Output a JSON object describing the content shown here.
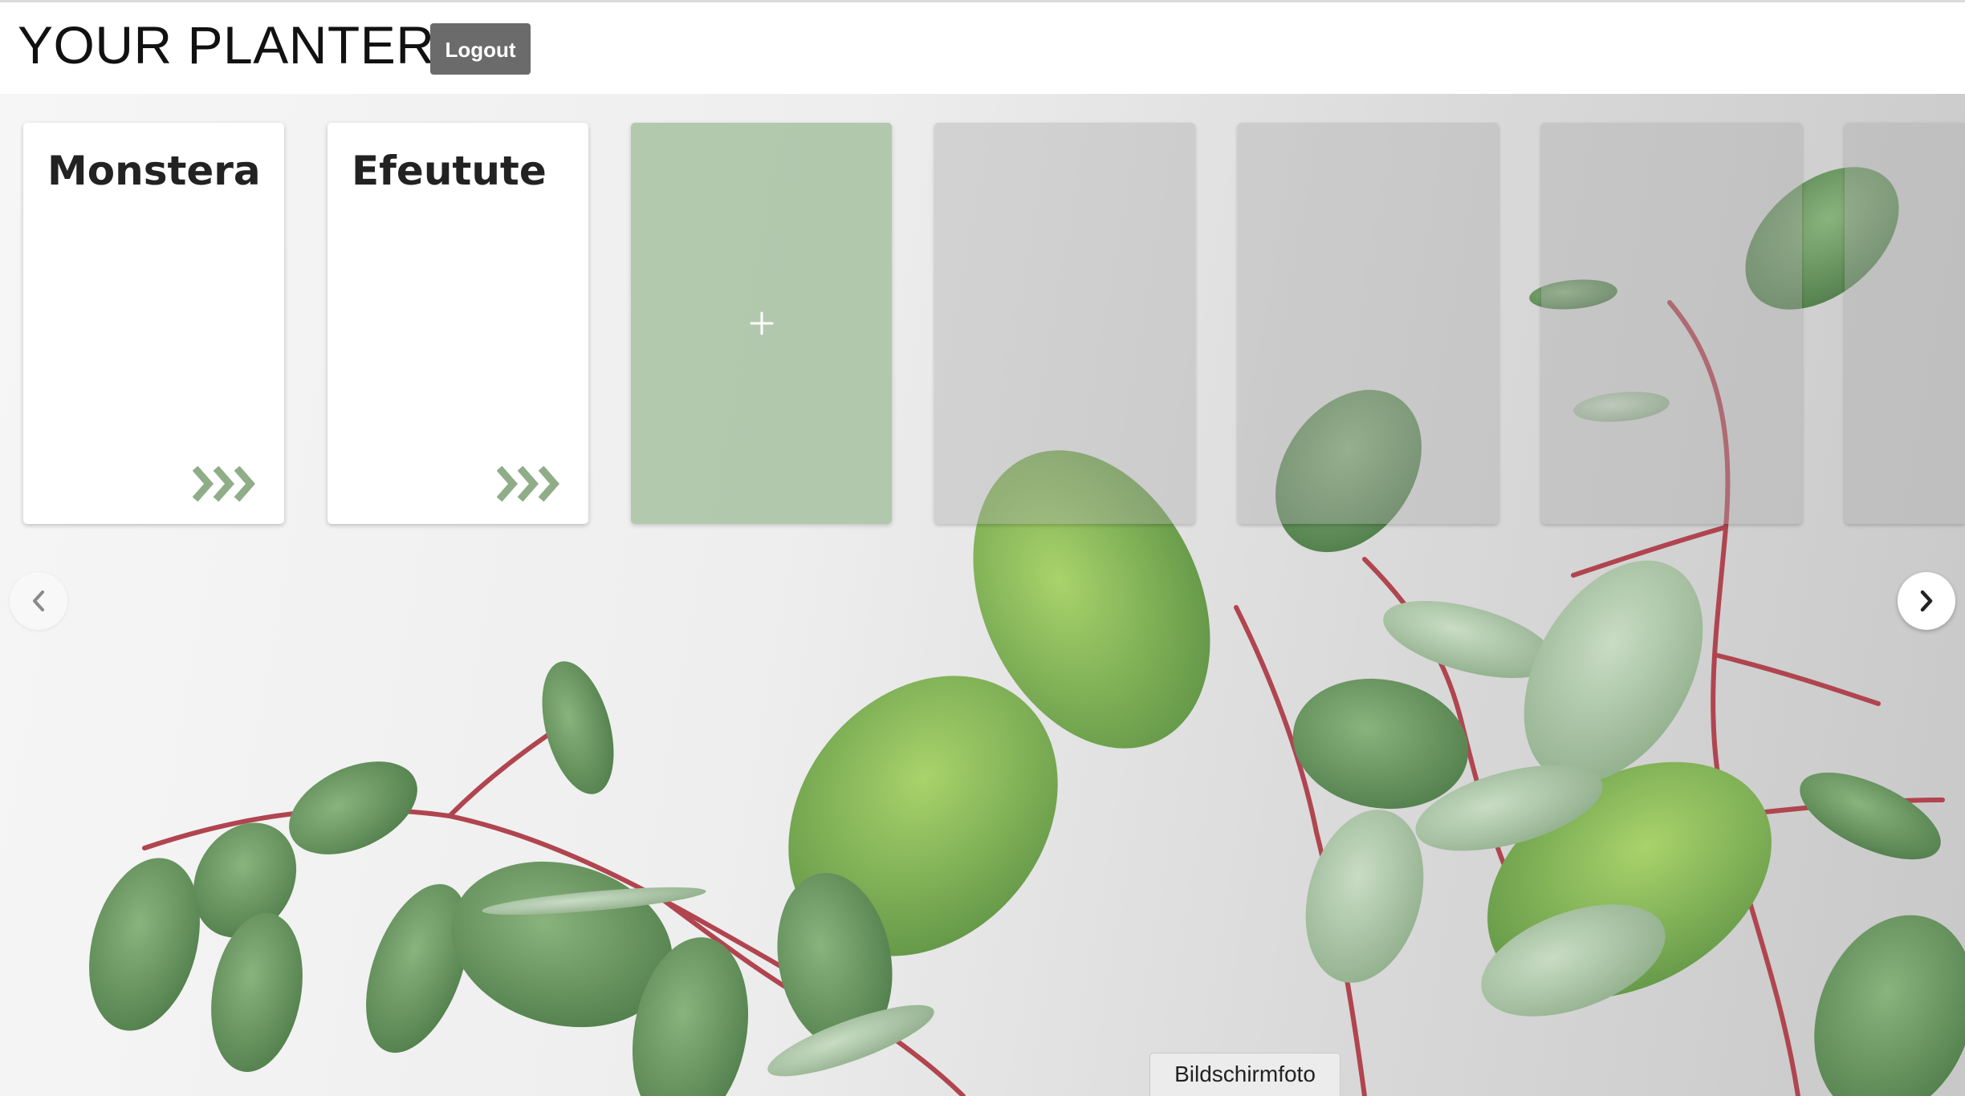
{
  "header": {
    "title": "YOUR PLANTER",
    "logout_label": "Logout"
  },
  "carousel": {
    "cards": [
      {
        "type": "plant",
        "name": "Monstera",
        "icon": "triple-chevron-right-icon"
      },
      {
        "type": "plant",
        "name": "Efeutute",
        "icon": "triple-chevron-right-icon"
      },
      {
        "type": "add",
        "icon": "plus-icon"
      },
      {
        "type": "empty"
      },
      {
        "type": "empty"
      },
      {
        "type": "empty"
      },
      {
        "type": "empty"
      }
    ],
    "prev_icon": "chevron-left-icon",
    "next_icon": "chevron-right-icon"
  },
  "tooltip": {
    "text": "Bildschirmfoto"
  },
  "colors": {
    "accent_green": "#8fae88",
    "add_card": "#a0be9b",
    "logout_bg": "#6b6b6b",
    "leaf_green": "#6f9a5c",
    "stem_red": "#b0454f"
  }
}
